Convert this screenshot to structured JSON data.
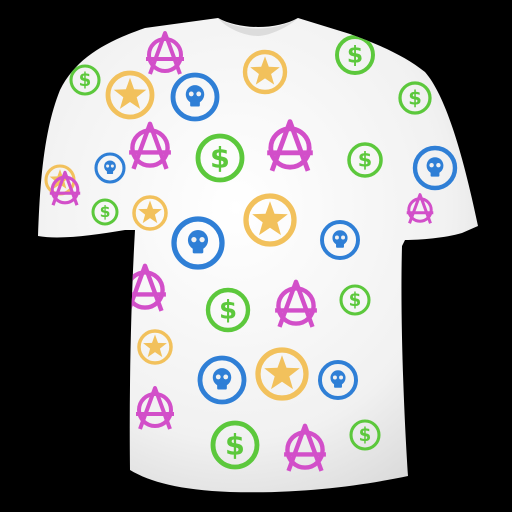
{
  "colors": {
    "background": "#000000",
    "shirt": "#f1f1f1",
    "shirt_shade": "#d9d9d9",
    "pink": "#d24fc9",
    "green": "#5cc83c",
    "orange": "#f2c15c",
    "blue": "#2f7fd6"
  },
  "pattern": {
    "motifs": [
      "skull-badge-icon",
      "dollar-badge-icon",
      "star-badge-icon",
      "anarchy-symbol-icon"
    ]
  }
}
